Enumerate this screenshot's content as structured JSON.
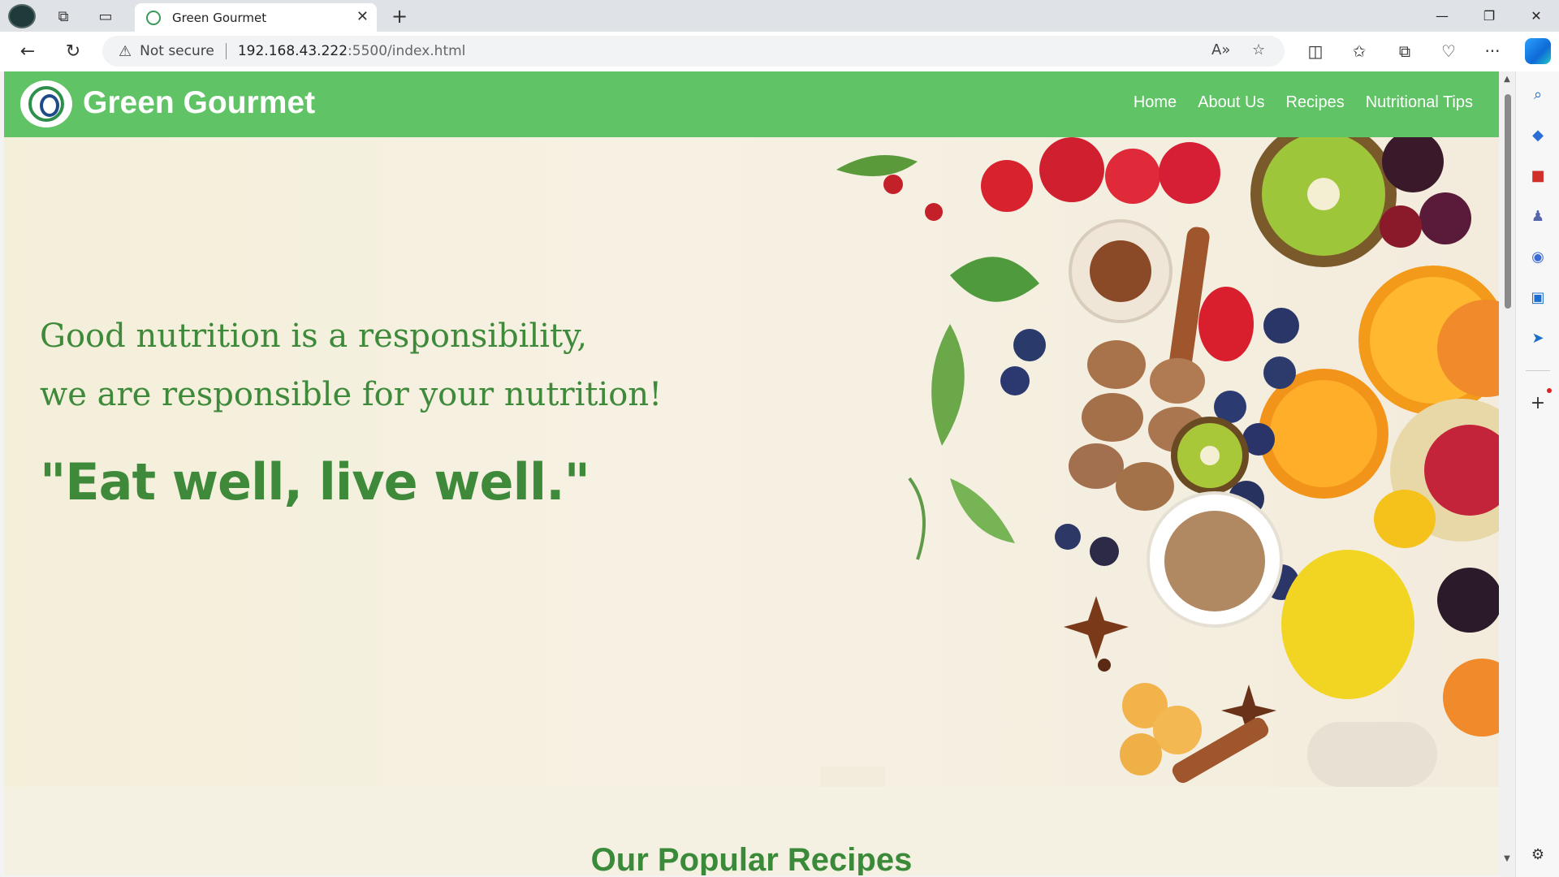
{
  "browser": {
    "tab_title": "Green Gourmet",
    "security_label": "Not secure",
    "url_host": "192.168.43.222",
    "url_rest": ":5500/index.html"
  },
  "site": {
    "brand": "Green Gourmet",
    "nav": [
      "Home",
      "About Us",
      "Recipes",
      "Nutritional Tips"
    ],
    "tagline_line1": "Good nutrition is a responsibility,",
    "tagline_line2": "we are responsible for your nutrition!",
    "motto": "\"Eat well, live well.\"",
    "section_heading": "Our Popular Recipes"
  },
  "colors": {
    "nav_green": "#60c466",
    "text_green": "#3e8a3a",
    "hero_bg": "#f5f1e2"
  },
  "icons": {
    "sidebar": [
      "search-icon",
      "shopping-tag-icon",
      "toolbox-icon",
      "games-icon",
      "office-icon",
      "outlook-icon",
      "send-icon",
      "add-icon",
      "settings-icon"
    ]
  }
}
